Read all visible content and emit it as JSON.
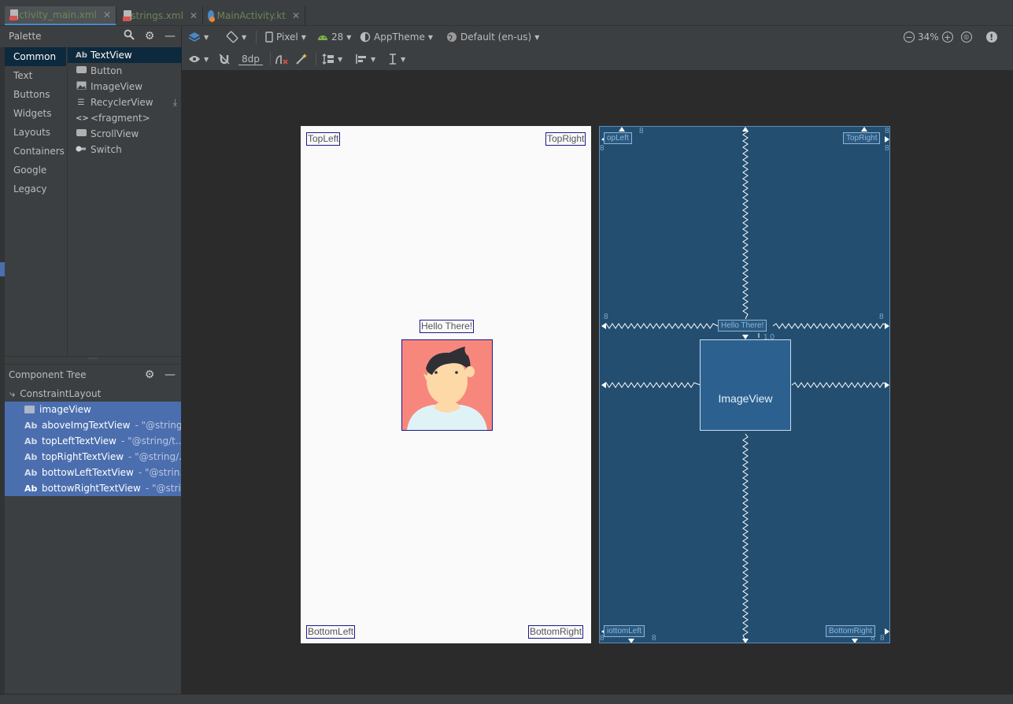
{
  "tabs": [
    {
      "label": "activity_main.xml",
      "color": "#6a8759",
      "active": true
    },
    {
      "label": "strings.xml",
      "color": "#6a8759",
      "active": false
    },
    {
      "label": "MainActivity.kt",
      "color": "#6a8759",
      "active": false
    }
  ],
  "palette": {
    "title": "Palette",
    "categories": [
      "Common",
      "Text",
      "Buttons",
      "Widgets",
      "Layouts",
      "Containers",
      "Google",
      "Legacy"
    ],
    "items": [
      "TextView",
      "Button",
      "ImageView",
      "RecyclerView",
      "<fragment>",
      "ScrollView",
      "Switch"
    ],
    "textview_prefix": "Ab"
  },
  "component_tree": {
    "title": "Component Tree",
    "root": "ConstraintLayout",
    "rows": [
      {
        "name": "imageView",
        "detail": ""
      },
      {
        "name": "aboveImgTextView",
        "detail": "- \"@string..."
      },
      {
        "name": "topLeftTextView",
        "detail": "- \"@string/t..."
      },
      {
        "name": "topRightTextView",
        "detail": "- \"@string/..."
      },
      {
        "name": "bottowLeftTextView",
        "detail": "- \"@strin..."
      },
      {
        "name": "bottowRightTextView",
        "detail": "- \"@stri..."
      }
    ],
    "ab": "Ab"
  },
  "toolbar": {
    "device": "Pixel",
    "api": "28",
    "theme": "AppTheme",
    "locale": "Default (en-us)",
    "zoom": "34%",
    "margin": "8dp"
  },
  "design": {
    "top_left": "TopLeft",
    "top_right": "TopRight",
    "bottom_left": "BottomLeft",
    "bottom_right": "BottomRight",
    "hello": "Hello There!"
  },
  "blueprint": {
    "top_left": "opLeft",
    "top_right": "TopRight",
    "bottom_left": "iottomLeft",
    "bottom_right": "BottomRight",
    "hello": "Hello There!",
    "image_label": "ImageView",
    "margin": "8",
    "bias": "1.0"
  },
  "colors": {
    "selection": "#4b6eaf",
    "blueprint_bg": "#234e70",
    "avatar_bg": "#f7877d"
  }
}
